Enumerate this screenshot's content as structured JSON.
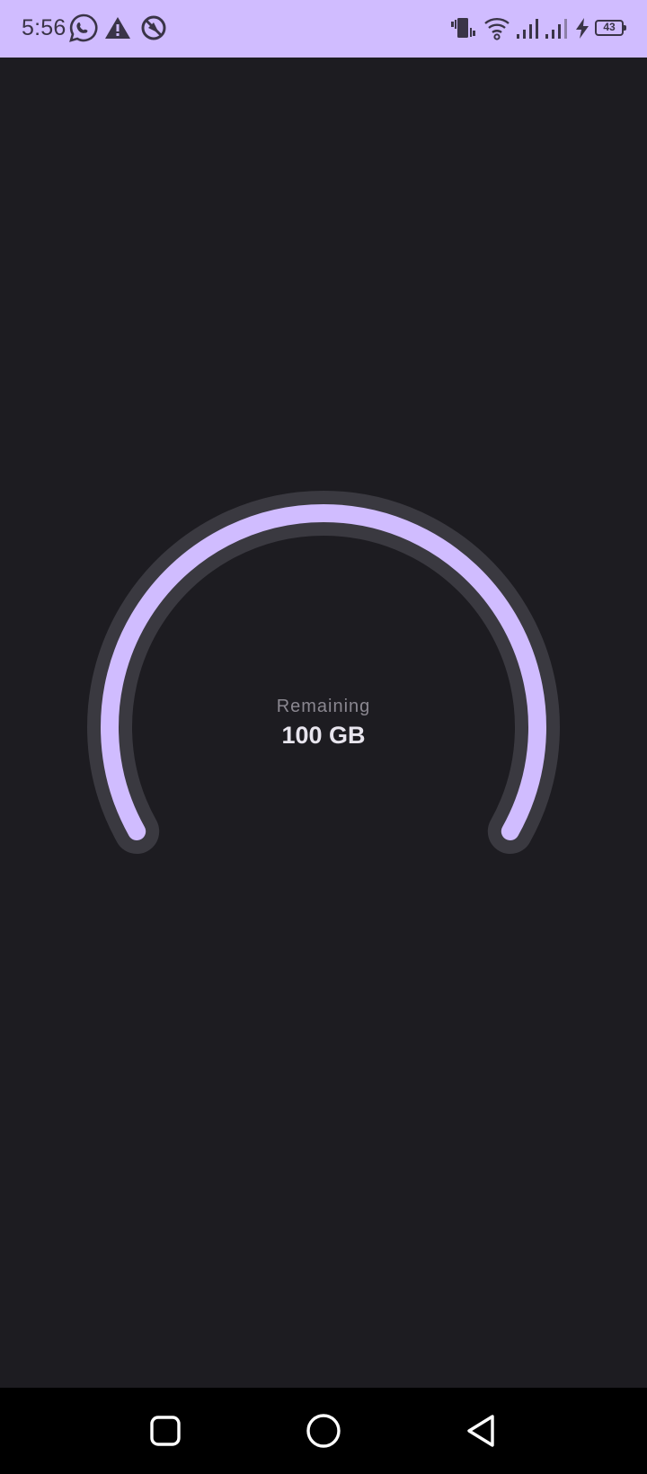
{
  "status_bar": {
    "time": "5:56",
    "battery_level": "43",
    "icons_left": [
      "whatsapp-icon",
      "warning-icon",
      "no-tracking-icon"
    ],
    "icons_right": [
      "vibrate-icon",
      "wifi-icon",
      "signal-icon",
      "signal-icon",
      "charging-icon",
      "battery-icon"
    ],
    "background_color": "#d0bcff"
  },
  "gauge": {
    "label": "Remaining",
    "value": "100 GB",
    "fill_fraction": 1.0,
    "track_color": "#3a3940",
    "fill_color": "#d0bcff"
  },
  "nav_bar": {
    "buttons": [
      "recents-icon",
      "home-icon",
      "back-icon"
    ]
  },
  "theme": {
    "background": "#1d1c21"
  }
}
